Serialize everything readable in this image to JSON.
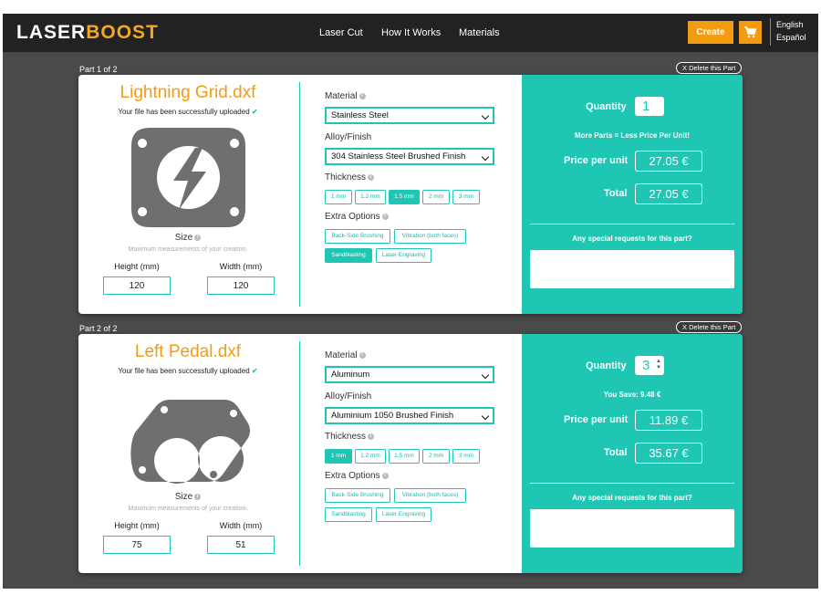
{
  "header": {
    "logo_a": "LASER",
    "logo_b": "BOOST",
    "nav": [
      "Laser Cut",
      "How It Works",
      "Materials"
    ],
    "create_label": "Create",
    "languages": [
      "English",
      "Español"
    ]
  },
  "colors": {
    "accent": "#1fc6b4",
    "brand": "#f39c12",
    "background": "#4a4a4a"
  },
  "parts": [
    {
      "part_label": "Part 1 of 2",
      "delete_label": "X Delete this Part",
      "file_name": "Lightning Grid.dxf",
      "upload_msg": "Your file has been successfully uploaded",
      "size_label": "Size",
      "size_hint": "Maximum measurements of your creation.",
      "height_label": "Height (mm)",
      "width_label": "Width (mm)",
      "height_value": "120",
      "width_value": "120",
      "material_label": "Material",
      "material_value": "Stainless Steel",
      "finish_label": "Alloy/Finish",
      "finish_value": "304 Stainless Steel Brushed Finish",
      "thickness_label": "Thickness",
      "thickness": [
        "1 mm",
        "1.2 mm",
        "1.5 mm",
        "2 mm",
        "3 mm"
      ],
      "thickness_selected": "1.5 mm",
      "extras_label": "Extra Options",
      "extras": [
        "Back-Side Brushing",
        "Vibration (both faces)",
        "Sandblasting",
        "Laser Engraving"
      ],
      "extras_selected": [
        "Sandblasting"
      ],
      "quantity_label": "Quantity",
      "quantity": "1",
      "note": "More Parts = Less Price Per Unit!",
      "ppu_label": "Price per unit",
      "ppu_value": "27.05 €",
      "total_label": "Total",
      "total_value": "27.05 €",
      "requests_label": "Any special requests for this part?"
    },
    {
      "part_label": "Part 2 of 2",
      "delete_label": "X Delete this Part",
      "file_name": "Left Pedal.dxf",
      "upload_msg": "Your file has been successfully uploaded",
      "size_label": "Size",
      "size_hint": "Maximum measurements of your creation.",
      "height_label": "Height (mm)",
      "width_label": "Width (mm)",
      "height_value": "75",
      "width_value": "51",
      "material_label": "Material",
      "material_value": "Aluminum",
      "finish_label": "Alloy/Finish",
      "finish_value": "Aluminium 1050 Brushed Finish",
      "thickness_label": "Thickness",
      "thickness": [
        "1 mm",
        "1.2 mm",
        "1.5 mm",
        "2 mm",
        "3 mm"
      ],
      "thickness_selected": "1 mm",
      "extras_label": "Extra Options",
      "extras": [
        "Back-Side Brushing",
        "Vibration (both faces)",
        "Sandblasting",
        "Laser Engraving"
      ],
      "extras_selected": [],
      "quantity_label": "Quantity",
      "quantity": "3",
      "note": "You Save: 9.48 €",
      "ppu_label": "Price per unit",
      "ppu_value": "11.89 €",
      "total_label": "Total",
      "total_value": "35.67 €",
      "requests_label": "Any special requests for this part?"
    }
  ]
}
